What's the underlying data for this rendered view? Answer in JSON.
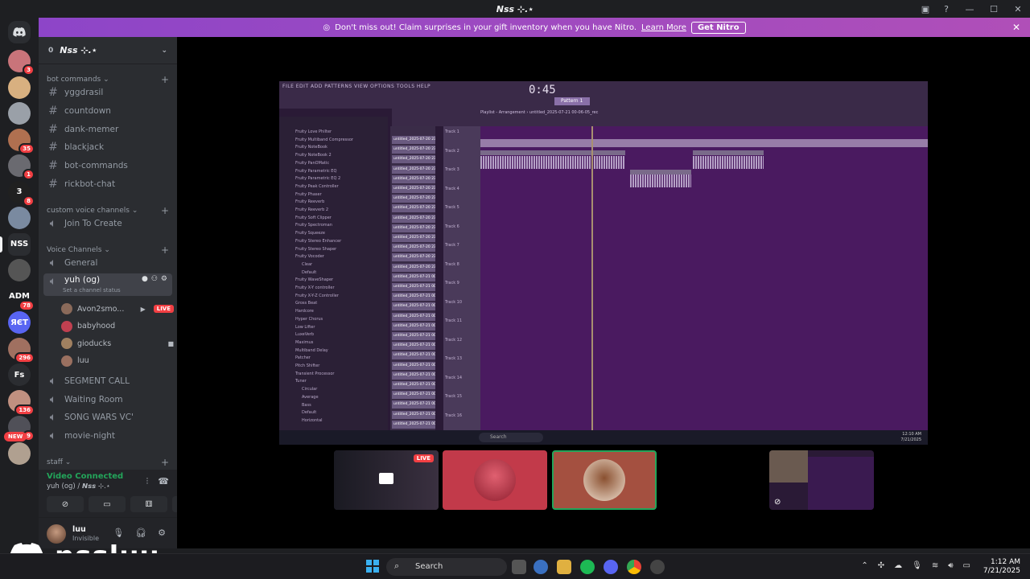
{
  "window": {
    "title": "𝙉𝙨𝙨 ⊹.⋆",
    "controls": [
      "—",
      "☐",
      "✕"
    ],
    "inbox_icon": "inbox-icon",
    "help_icon": "help-icon"
  },
  "nitro_banner": {
    "text": "Don't miss out! Claim surprises in your gift inventory when you have Nitro.",
    "link": "Learn More",
    "button": "Get Nitro"
  },
  "servers": [
    {
      "badge": "3",
      "color": "#c9747a"
    },
    {
      "badge": "",
      "color": "#d8b080"
    },
    {
      "badge": "",
      "color": "#9aa0a8"
    },
    {
      "badge": "35",
      "color": "#b07050"
    },
    {
      "badge": "1",
      "color": "#6a6a70"
    },
    {
      "badge": "8",
      "color": "#202020",
      "label": "3"
    },
    {
      "badge": "",
      "color": "#7a8aa0"
    },
    {
      "badge": "",
      "color": "#2b2d31",
      "label": "NSS",
      "selected": true
    },
    {
      "badge": "",
      "color": "#555"
    },
    {
      "badge": "78",
      "color": "#1e1f22",
      "label": "ADM"
    },
    {
      "badge": "",
      "color": "#5865f2",
      "label": "ЯЄТ"
    },
    {
      "badge": "296",
      "color": "#a07060"
    },
    {
      "badge": "",
      "color": "#2b2d31",
      "label": "Fs"
    },
    {
      "badge": "136",
      "color": "#c09080"
    },
    {
      "badge": "9",
      "color": "#505058"
    },
    {
      "badge": "",
      "color": "#b0a090"
    }
  ],
  "new_badge": "NEW",
  "guild": {
    "name": "𝙉𝙨𝙨 ⊹.⋆",
    "boost": "0"
  },
  "categories": {
    "bot": "bot commands",
    "custom": "custom voice channels",
    "voice": "Voice Channels",
    "staff": "staff"
  },
  "text_channels": [
    "yggdrasil",
    "countdown",
    "dank-memer",
    "blackjack",
    "bot-commands",
    "rickbot-chat"
  ],
  "custom_voice": [
    "Join To Create"
  ],
  "voice_channels": {
    "general": "General",
    "active": {
      "name": "yuh (og)",
      "status": "Set a channel status"
    },
    "members": [
      {
        "name": "Avon2smo...",
        "live": "LIVE",
        "color": "#8a6a5a"
      },
      {
        "name": "babyhood",
        "color": "#c04050"
      },
      {
        "name": "gioducks",
        "color": "#a08060"
      },
      {
        "name": "luu",
        "color": "#9a7060"
      }
    ],
    "others": [
      "SEGMENT CALL",
      "Waiting Room",
      "SONG WARS VC'",
      "movie-night"
    ]
  },
  "voice_panel": {
    "status": "Video Connected",
    "location": "yuh (og) / 𝙉𝙨𝙨 ⊹.⋆"
  },
  "user": {
    "name": "luu",
    "status": "Invisible"
  },
  "stream": {
    "menu": "FILE EDIT ADD PATTERNS VIEW OPTIONS TOOLS HELP",
    "time": "0:45",
    "pattern": "Pattern 1",
    "playlist_title": "Playlist - Arrangement › untitled_2025-07-21 00-06-05_rec",
    "plugins": [
      "Fruity Love Philter",
      "Fruity Multiband Compressor",
      "Fruity NoteBook",
      "Fruity NoteBook 2",
      "Fruity PanOMatic",
      "Fruity Parametric EQ",
      "Fruity Parametric EQ 2",
      "Fruity Peak Controller",
      "Fruity Phaser",
      "Fruity Reeverb",
      "Fruity Reeverb 2",
      "Fruity Soft Clipper",
      "Fruity Spectroman",
      "Fruity Squeeze",
      "Fruity Stereo Enhancer",
      "Fruity Stereo Shaper",
      "Fruity Vocoder",
      "Clear",
      "Default",
      "Fruity WaveShaper",
      "Fruity X-Y controller",
      "Fruity X-Y-Z Controller",
      "Gross Beat",
      "Hardcore",
      "Hyper Chorus",
      "Low Lifter",
      "LuxeVerb",
      "Maximus",
      "Multiband Delay",
      "Patcher",
      "Pitch Shifter",
      "Transient Processor",
      "Tuner",
      "Circular",
      "Average",
      "Bass",
      "Default",
      "Horizontal"
    ],
    "clips": [
      "untitled_2025-07-20 23-...",
      "untitled_2025-07-20 23-...",
      "untitled_2025-07-20 23-...",
      "untitled_2025-07-20 23-...",
      "untitled_2025-07-20 23-...",
      "untitled_2025-07-20 23-...",
      "untitled_2025-07-20 23-...",
      "untitled_2025-07-20 23-...",
      "untitled_2025-07-20 23-...",
      "untitled_2025-07-20 23-...",
      "untitled_2025-07-20 23-...",
      "untitled_2025-07-20 23-...",
      "untitled_2025-07-20 23-...",
      "untitled_2025-07-20 23-...",
      "untitled_2025-07-21 00-...",
      "untitled_2025-07-21 00-...",
      "untitled_2025-07-21 00-...",
      "untitled_2025-07-21 00-...",
      "untitled_2025-07-21 00-...",
      "untitled_2025-07-21 00-...",
      "untitled_2025-07-21 00-...",
      "untitled_2025-07-21 00-...",
      "untitled_2025-07-21 00-...",
      "untitled_2025-07-21 00-...",
      "untitled_2025-07-21 00-...",
      "untitled_2025-07-21 00-...",
      "untitled_2025-07-21 00-...",
      "untitled_2025-07-21 00-...",
      "untitled_2025-07-21 00-...",
      "untitled_2025-07-21 00-..."
    ],
    "tracks": [
      "Track 1",
      "Track 2",
      "Track 3",
      "Track 4",
      "Track 5",
      "Track 6",
      "Track 7",
      "Track 8",
      "Track 9",
      "Track 10",
      "Track 11",
      "Track 12",
      "Track 13",
      "Track 14",
      "Track 15",
      "Track 16"
    ],
    "inner_search": "Search",
    "inner_clock": [
      "12:10 AM",
      "7/21/2025"
    ]
  },
  "tiles": {
    "live": "LIVE"
  },
  "taskbar": {
    "search": "Search",
    "time": "1:12 AM",
    "date": "7/21/2025"
  },
  "watermark": "nssluu"
}
